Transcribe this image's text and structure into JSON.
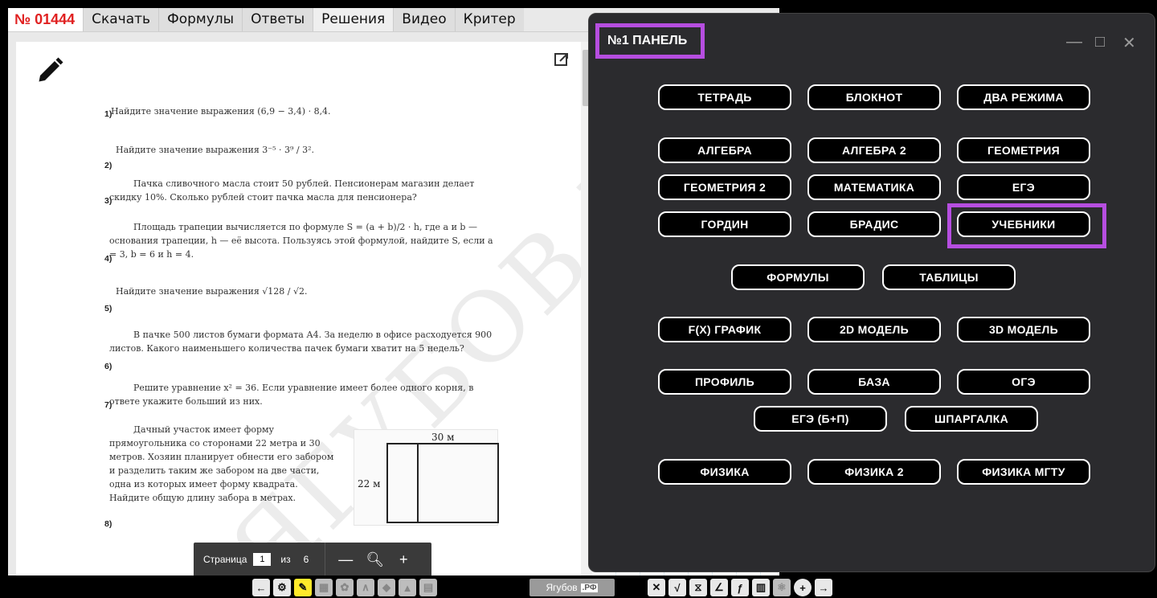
{
  "tabs": {
    "id": "№ 01444",
    "items": [
      "Скачать",
      "Формулы",
      "Ответы",
      "Решения",
      "Видео",
      "Критер"
    ]
  },
  "document": {
    "watermark": "ЯГУБОВ.РФ",
    "problems": [
      {
        "num": "1)",
        "text": "Найдите значение выражения (6,9 − 3,4) · 8,4."
      },
      {
        "num": "2)",
        "text": "Найдите значение выражения 3⁻⁵ · 3⁹ / 3²."
      },
      {
        "num": "3)",
        "text": "Пачка сливочного масла стоит 50 рублей. Пенсионерам магазин делает скидку 10%. Сколько рублей стоит пачка масла для пенсионера?"
      },
      {
        "num": "4)",
        "text": "Площадь трапеции вычисляется по формуле S = (a + b)/2 · h, где a и b — основания трапеции, h — её высота. Пользуясь этой формулой, найдите S, если a = 3, b = 6 и h = 4."
      },
      {
        "num": "5)",
        "text": "Найдите значение выражения √128 / √2."
      },
      {
        "num": "6)",
        "text": "В пачке 500 листов бумаги формата А4. За неделю в офисе расходуется 900 листов. Какого наименьшего количества пачек бумаги хватит на 5 недель?"
      },
      {
        "num": "7)",
        "text": "Решите уравнение x² = 36. Если уравнение имеет более одного корня, в ответе укажите больший из них."
      },
      {
        "num": "8)",
        "text": "Дачный участок имеет форму прямоугольника со сторонами 22 метра и 30 метров. Хозяин планирует обнести его забором и разделить таким же забором на две части, одна из которых имеет форму квадрата. Найдите общую длину забора в метрах."
      }
    ],
    "figure": {
      "top_label": "30 м",
      "left_label": "22 м"
    }
  },
  "pager": {
    "label": "Страница",
    "current": "1",
    "of": "из",
    "total": "6",
    "zoom_out": "—",
    "zoom_in": "+"
  },
  "toolbar": {
    "brand": "Ягубов",
    "brand_suffix": ".РФ",
    "icons": [
      "arrow-left-icon",
      "gear-icon",
      "pencil-icon",
      "calculator-icon",
      "brain-icon",
      "graph-icon",
      "shape-icon",
      "triangle-icon",
      "notebook-icon",
      "close-icon",
      "sqrt-icon",
      "hourglass-icon",
      "angle-icon",
      "fx-icon",
      "clipboard-icon",
      "atom-icon",
      "plus-circle-icon",
      "arrow-right-icon"
    ]
  },
  "panel": {
    "title": "№1 ПАНЕЛЬ",
    "buttons": {
      "tetrad": "ТЕТРАДЬ",
      "bloknot": "БЛОКНОТ",
      "dva_rezhima": "ДВА РЕЖИМА",
      "algebra": "АЛГЕБРА",
      "algebra2": "АЛГЕБРА 2",
      "geometria": "ГЕОМЕТРИЯ",
      "geometria2": "ГЕОМЕТРИЯ 2",
      "matematika": "МАТЕМАТИКА",
      "ege": "ЕГЭ",
      "gordin": "ГОРДИН",
      "bradis": "БРАДИС",
      "uchebniki": "УЧЕБНИКИ",
      "formuly": "ФОРМУЛЫ",
      "tablicy": "ТАБЛИЦЫ",
      "fx_grafik": "F(X) ГРАФИК",
      "model2d": "2D МОДЕЛЬ",
      "model3d": "3D МОДЕЛЬ",
      "profil": "ПРОФИЛЬ",
      "baza": "БАЗА",
      "oge": "ОГЭ",
      "ege_bp": "ЕГЭ (Б+П)",
      "shpargalka": "ШПАРГАЛКА",
      "fizika": "ФИЗИКА",
      "fizika2": "ФИЗИКА 2",
      "fizika_mgtu": "ФИЗИКА МГТУ"
    },
    "highlight_color": "#b64ee0"
  }
}
